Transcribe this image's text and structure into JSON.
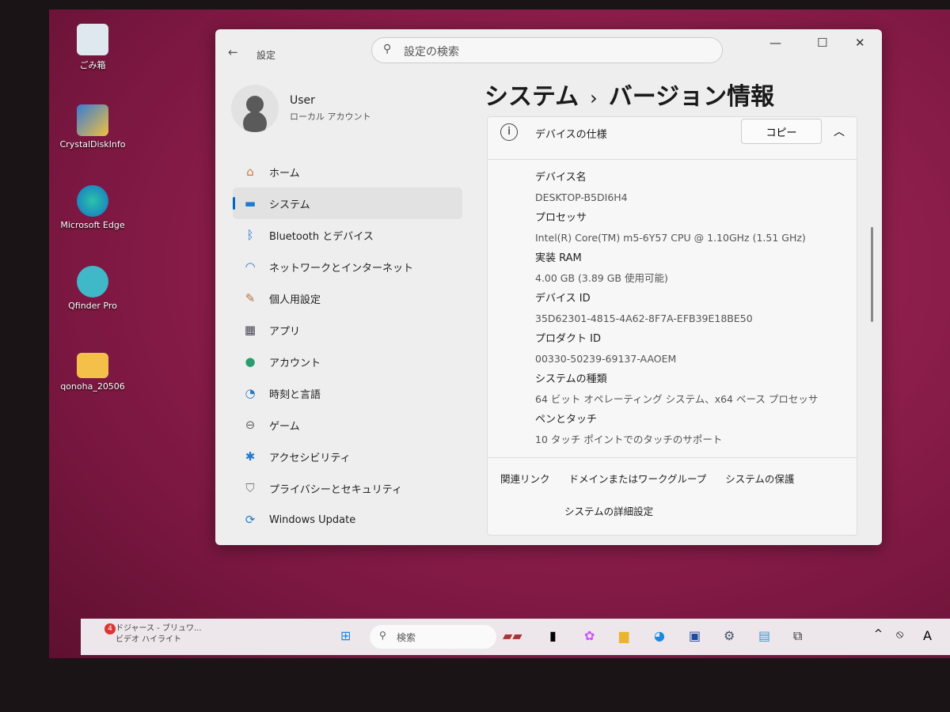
{
  "desktop": {
    "icons": [
      {
        "label": "ごみ箱",
        "icon": "recycle-bin-icon"
      },
      {
        "label": "CrystalDiskInfo",
        "icon": "crystaldiskinfo-icon"
      },
      {
        "label": "Microsoft Edge",
        "icon": "edge-icon"
      },
      {
        "label": "Qfinder Pro",
        "icon": "qfinder-icon"
      },
      {
        "label": "qonoha_20506",
        "icon": "folder-icon"
      }
    ]
  },
  "window": {
    "title": "設定",
    "search_placeholder": "設定の検索"
  },
  "user": {
    "name": "User",
    "type": "ローカル アカウント"
  },
  "nav": [
    {
      "label": "ホーム"
    },
    {
      "label": "システム",
      "active": true
    },
    {
      "label": "Bluetooth とデバイス"
    },
    {
      "label": "ネットワークとインターネット"
    },
    {
      "label": "個人用設定"
    },
    {
      "label": "アプリ"
    },
    {
      "label": "アカウント"
    },
    {
      "label": "時刻と言語"
    },
    {
      "label": "ゲーム"
    },
    {
      "label": "アクセシビリティ"
    },
    {
      "label": "プライバシーとセキュリティ"
    },
    {
      "label": "Windows Update"
    }
  ],
  "breadcrumb": {
    "parent": "システム",
    "sep": "›",
    "current": "バージョン情報"
  },
  "device_spec": {
    "title": "デバイスの仕様",
    "copy": "コピー",
    "items": [
      {
        "label": "デバイス名",
        "value": "DESKTOP-B5DI6H4"
      },
      {
        "label": "プロセッサ",
        "value": "Intel(R) Core(TM) m5-6Y57 CPU @ 1.10GHz (1.51 GHz)"
      },
      {
        "label": "実装 RAM",
        "value": "4.00 GB (3.89 GB 使用可能)"
      },
      {
        "label": "デバイス ID",
        "value": "35D62301-4815-4A62-8F7A-EFB39E18BE50"
      },
      {
        "label": "プロダクト ID",
        "value": "00330-50239-69137-AAOEM"
      },
      {
        "label": "システムの種類",
        "value": "64 ビット オペレーティング システム、x64 ベース プロセッサ"
      },
      {
        "label": "ペンとタッチ",
        "value": "10 タッチ ポイントでのタッチのサポート"
      }
    ]
  },
  "related": {
    "label": "関連リンク",
    "links": [
      "ドメインまたはワークグループ",
      "システムの保護",
      "システムの詳細設定"
    ]
  },
  "taskbar": {
    "news_line1": "ドジャース - ブリュワ...",
    "news_line2": "ビデオ ハイライト",
    "badge": "4",
    "search": "検索",
    "tray_letter": "A"
  }
}
